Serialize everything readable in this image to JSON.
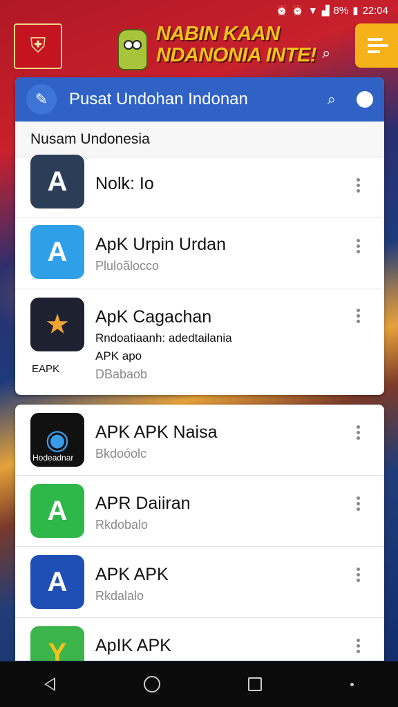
{
  "status_bar": {
    "time": "22:04",
    "battery": "8%"
  },
  "banner": {
    "title": "NABIN KAAN NDANONIA INTE!"
  },
  "app_bar": {
    "title": "Pusat Undohan Indonan"
  },
  "section": {
    "title": "Nusam Undonesia"
  },
  "card1_apps": [
    {
      "name": "Nolk: Io",
      "subtitle": ""
    },
    {
      "name": "ApK Urpin  Urdan",
      "subtitle": "Pluloãlocco"
    },
    {
      "name": "ApK Cagachan",
      "line1": "Rndoatiaanh: adedtailania",
      "line2": "APK apo",
      "subtitle": "DBabaob",
      "icon_label": "EAPK"
    }
  ],
  "card2_apps": [
    {
      "name": "APK APK Naisa",
      "subtitle": "Bkdoóolc",
      "icon_label": "Hodeadnar"
    },
    {
      "name": "APR Daiiran",
      "subtitle": "Rkdobalo"
    },
    {
      "name": "APK APK",
      "subtitle": "Rkdalalo"
    },
    {
      "name": "ApIK APK",
      "subtitle": ""
    }
  ],
  "colors": {
    "app_bar": "#2f62c4",
    "banner_title": "#f3c21a",
    "menu_button": "#f6b21a"
  }
}
